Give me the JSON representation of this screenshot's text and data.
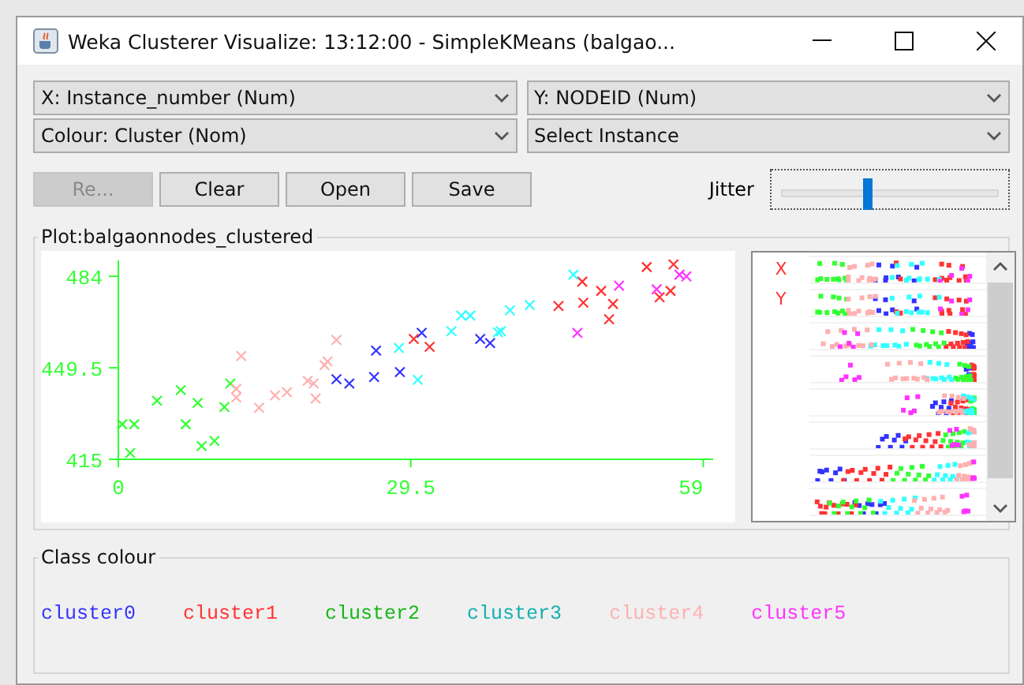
{
  "window": {
    "title": "Weka Clusterer Visualize: 13:12:00 - SimpleKMeans (balgao..."
  },
  "selectors": [
    {
      "value": "X: Instance_number (Num)"
    },
    {
      "value": "Y: NODEID (Num)"
    },
    {
      "value": "Colour: Cluster (Nom)"
    },
    {
      "value": "Select Instance"
    }
  ],
  "buttons": [
    {
      "label": "Re...",
      "disabled": true
    },
    {
      "label": "Clear",
      "disabled": false
    },
    {
      "label": "Open",
      "disabled": false
    },
    {
      "label": "Save",
      "disabled": false
    }
  ],
  "jitter": {
    "label": "Jitter",
    "level": 0.4
  },
  "plot_panel": {
    "title": "Plot:balgaonnodes_clustered",
    "chart_data": {
      "type": "scatter",
      "xlim": [
        0,
        60
      ],
      "ylim": [
        415,
        490
      ],
      "xticks": [
        {
          "value": 0,
          "label": "0"
        },
        {
          "value": 29.5,
          "label": "29.5"
        },
        {
          "value": 59,
          "label": "59"
        }
      ],
      "yticks": [
        {
          "value": 415,
          "label": "415"
        },
        {
          "value": 449.5,
          "label": "449.5"
        },
        {
          "value": 484,
          "label": "484"
        }
      ],
      "series": [
        {
          "color": "#3333ff",
          "x": [
            22.0,
            23.3,
            26.0,
            25.8,
            28.4,
            30.6,
            36.5,
            37.5
          ],
          "values": [
            445.2,
            443.6,
            456.0,
            446.0,
            447.9,
            462.7,
            460.4,
            458.8
          ]
        },
        {
          "color": "#ff3333",
          "x": [
            29.8,
            31.4,
            44.4,
            46.8,
            46.9,
            48.7,
            49.5,
            49.9,
            53.3,
            54.6,
            55.7,
            56.0
          ],
          "values": [
            460.4,
            457.4,
            472.8,
            482.0,
            474.1,
            478.5,
            467.8,
            473.6,
            487.5,
            476.1,
            478.5,
            488.5
          ]
        },
        {
          "color": "#33ff33",
          "x": [
            0.4,
            1.6,
            1.2,
            3.9,
            6.3,
            6.8,
            8.0,
            8.4,
            9.7,
            10.7,
            11.3
          ],
          "values": [
            428.2,
            428.2,
            417.4,
            437.1,
            441.1,
            428.2,
            436.3,
            420.0,
            421.9,
            434.7,
            443.6
          ]
        },
        {
          "color": "#33ffff",
          "x": [
            28.3,
            30.2,
            33.6,
            34.6,
            35.5,
            38.3,
            38.6,
            39.5,
            41.5,
            45.9
          ],
          "values": [
            457.0,
            445.0,
            463.3,
            469.2,
            469.2,
            462.9,
            463.3,
            471.2,
            473.2,
            484.6
          ]
        },
        {
          "color": "#ffb0b0",
          "x": [
            12.4,
            11.9,
            11.9,
            14.2,
            15.8,
            17.0,
            19.1,
            19.7,
            19.9,
            20.8,
            21.1,
            22.0
          ],
          "values": [
            453.9,
            441.6,
            438.3,
            434.4,
            439.1,
            440.3,
            444.6,
            443.6,
            437.9,
            450.5,
            451.9,
            460.0
          ]
        },
        {
          "color": "#ff33ff",
          "x": [
            46.3,
            50.5,
            54.3,
            56.6,
            57.3
          ],
          "values": [
            462.7,
            480.5,
            479.1,
            484.6,
            484.0
          ]
        }
      ]
    },
    "attribute_labels": [
      "X",
      "Y"
    ]
  },
  "class_colour": {
    "title": "Class colour",
    "clusters": [
      {
        "label": "cluster0",
        "color": "#3333ff"
      },
      {
        "label": "cluster1",
        "color": "#ff3333"
      },
      {
        "label": "cluster2",
        "color": "#14b814"
      },
      {
        "label": "cluster3",
        "color": "#12b0b0"
      },
      {
        "label": "cluster4",
        "color": "#ffb0b0"
      },
      {
        "label": "cluster5",
        "color": "#ff33ff"
      }
    ]
  }
}
